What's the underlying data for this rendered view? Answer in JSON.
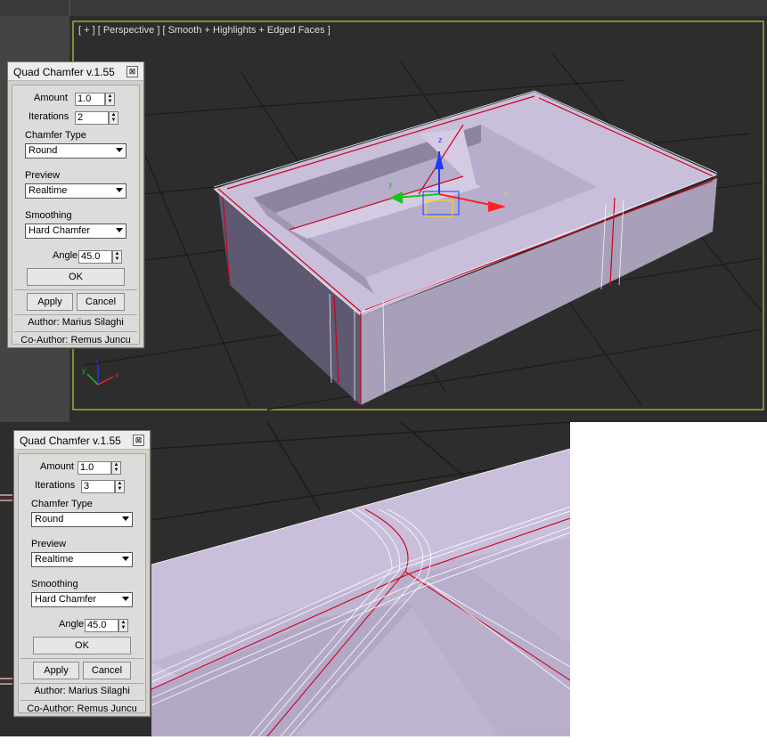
{
  "viewport_label": "[ + ] [ Perspective ] [ Smooth + Highlights + Edged Faces ]",
  "gizmo": {
    "x": "x",
    "y": "y",
    "z": "z"
  },
  "dialogs": [
    {
      "title": "Quad Chamfer v.1.55",
      "close_glyph": "⊠",
      "amount_label": "Amount",
      "amount_value": "1.0",
      "iterations_label": "Iterations",
      "iterations_value": "2",
      "chamfer_type_label": "Chamfer Type",
      "chamfer_type_value": "Round",
      "preview_label": "Preview",
      "preview_value": "Realtime",
      "smoothing_label": "Smoothing",
      "smoothing_value": "Hard Chamfer",
      "angle_label": "Angle",
      "angle_value": "45.0",
      "ok_label": "OK",
      "apply_label": "Apply",
      "cancel_label": "Cancel",
      "author": "Author: Marius Silaghi",
      "coauthor": "Co-Author: Remus Juncu"
    },
    {
      "title": "Quad Chamfer v.1.55",
      "close_glyph": "⊠",
      "amount_label": "Amount",
      "amount_value": "1.0",
      "iterations_label": "Iterations",
      "iterations_value": "3",
      "chamfer_type_label": "Chamfer Type",
      "chamfer_type_value": "Round",
      "preview_label": "Preview",
      "preview_value": "Realtime",
      "smoothing_label": "Smoothing",
      "smoothing_value": "Hard Chamfer",
      "angle_label": "Angle",
      "angle_value": "45.0",
      "ok_label": "OK",
      "apply_label": "Apply",
      "cancel_label": "Cancel",
      "author": "Author: Marius Silaghi",
      "coauthor": "Co-Author: Remus Juncu"
    }
  ],
  "colors": {
    "viewport_bg": "#2d2d2d",
    "grid": "#1b1b1b",
    "mesh_top": "#c9bfdb",
    "mesh_side": "#a89fb9",
    "mesh_dark": "#5e5870",
    "edge_red": "#d0001a",
    "edge_white": "#ffffff",
    "viewport_border": "#c8c832"
  }
}
